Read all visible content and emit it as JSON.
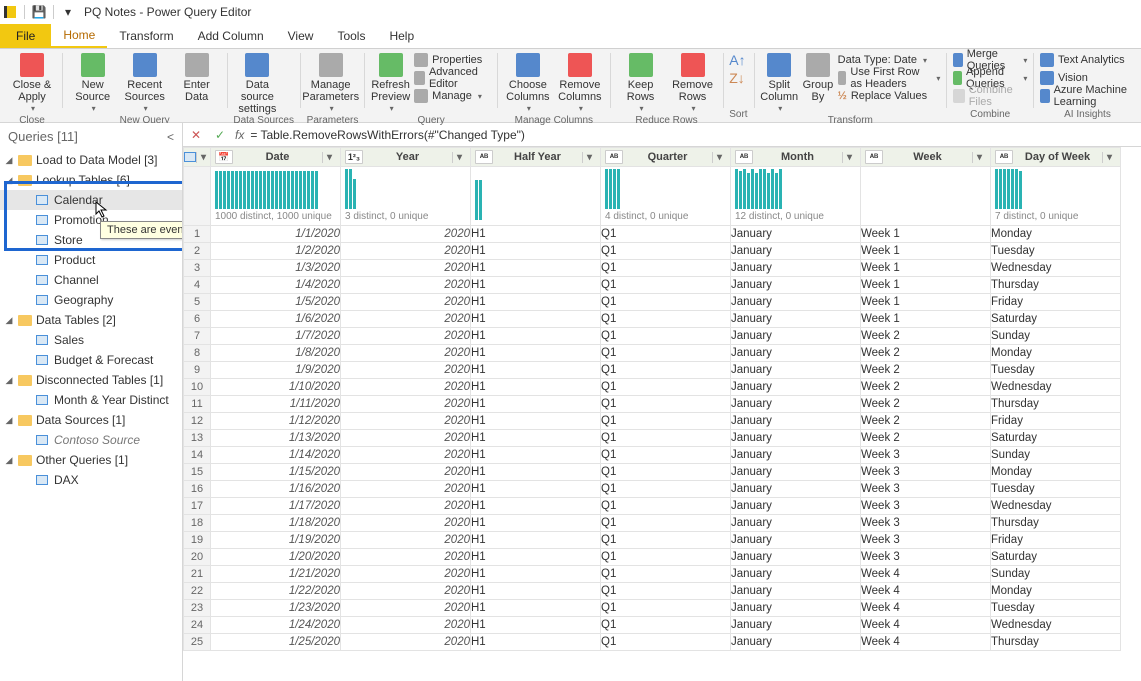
{
  "title": "PQ Notes - Power Query Editor",
  "menubar": {
    "file": "File",
    "home": "Home",
    "transform": "Transform",
    "addcol": "Add Column",
    "view": "View",
    "tools": "Tools",
    "help": "Help"
  },
  "ribbon": {
    "close": {
      "label": "Close &\nApply",
      "group": "Close"
    },
    "newq": {
      "new_source": "New\nSource",
      "recent": "Recent\nSources",
      "enter": "Enter\nData",
      "group": "New Query"
    },
    "ds": {
      "settings": "Data source\nsettings",
      "group": "Data Sources"
    },
    "params": {
      "manage": "Manage\nParameters",
      "group": "Parameters"
    },
    "query": {
      "refresh": "Refresh\nPreview",
      "props": "Properties",
      "adv": "Advanced Editor",
      "manage": "Manage",
      "group": "Query"
    },
    "mc": {
      "choose": "Choose\nColumns",
      "remove": "Remove\nColumns",
      "group": "Manage Columns"
    },
    "rr": {
      "keep": "Keep\nRows",
      "remove": "Remove\nRows",
      "group": "Reduce Rows"
    },
    "sort": {
      "group": "Sort"
    },
    "transform": {
      "split": "Split\nColumn",
      "groupby": "Group\nBy",
      "dtype": "Data Type: Date",
      "firstrow": "Use First Row as Headers",
      "replace": "Replace Values",
      "group": "Transform"
    },
    "combine": {
      "merge": "Merge Queries",
      "append": "Append Queries",
      "files": "Combine Files",
      "group": "Combine"
    },
    "ai": {
      "text": "Text Analytics",
      "vision": "Vision",
      "ml": "Azure Machine Learning",
      "group": "AI Insights"
    }
  },
  "sidebar": {
    "header": "Queries [11]",
    "g1": {
      "label": "Load to Data Model [3]"
    },
    "g2": {
      "label": "Lookup Tables [6]",
      "items": [
        "Calendar",
        "Promotion",
        "Store",
        "Product",
        "Channel",
        "Geography"
      ]
    },
    "g3": {
      "label": "Data Tables [2]",
      "items": [
        "Sales",
        "Budget & Forecast"
      ]
    },
    "g4": {
      "label": "Disconnected Tables [1]",
      "items": [
        "Month & Year Distinct"
      ]
    },
    "g5": {
      "label": "Data Sources [1]",
      "items": [
        "Contoso Source"
      ]
    },
    "g6": {
      "label": "Other Queries [1]",
      "items": [
        "DAX"
      ]
    }
  },
  "tooltip": "These are even more notes!",
  "formula": {
    "fx": "fx",
    "text": "= Table.RemoveRowsWithErrors(#\"Changed Type\")"
  },
  "columns": [
    {
      "name": "Date",
      "type": "date",
      "profile": "1000 distinct, 1000 unique",
      "bars": 26,
      "heights": [
        38,
        38,
        38,
        38,
        38,
        38,
        38,
        38,
        38,
        38,
        38,
        38,
        38,
        38,
        38,
        38,
        38,
        38,
        38,
        38,
        38,
        38,
        38,
        38,
        38,
        38
      ]
    },
    {
      "name": "Year",
      "type": "num",
      "profile": "3 distinct, 0 unique",
      "bars": 3,
      "heights": [
        40,
        40,
        30
      ]
    },
    {
      "name": "Half Year",
      "type": "text",
      "profile": "",
      "bars": 2,
      "heights": [
        40,
        40
      ]
    },
    {
      "name": "Quarter",
      "type": "text",
      "profile": "4 distinct, 0 unique",
      "bars": 4,
      "heights": [
        40,
        40,
        40,
        40
      ]
    },
    {
      "name": "Month",
      "type": "text",
      "profile": "12 distinct, 0 unique",
      "bars": 12,
      "heights": [
        40,
        38,
        40,
        36,
        40,
        36,
        40,
        40,
        36,
        40,
        36,
        40
      ]
    },
    {
      "name": "Week",
      "type": "text",
      "profile": "",
      "bars": 0,
      "heights": []
    },
    {
      "name": "Day of Week",
      "type": "text",
      "profile": "7 distinct, 0 unique",
      "bars": 7,
      "heights": [
        40,
        40,
        40,
        40,
        40,
        40,
        38
      ]
    }
  ],
  "rows": [
    {
      "n": 1,
      "Date": "1/1/2020",
      "Year": 2020,
      "Half Year": "H1",
      "Quarter": "Q1",
      "Month": "January",
      "Week": "Week 1",
      "Day of Week": "Monday"
    },
    {
      "n": 2,
      "Date": "1/2/2020",
      "Year": 2020,
      "Half Year": "H1",
      "Quarter": "Q1",
      "Month": "January",
      "Week": "Week 1",
      "Day of Week": "Tuesday"
    },
    {
      "n": 3,
      "Date": "1/3/2020",
      "Year": 2020,
      "Half Year": "H1",
      "Quarter": "Q1",
      "Month": "January",
      "Week": "Week 1",
      "Day of Week": "Wednesday"
    },
    {
      "n": 4,
      "Date": "1/4/2020",
      "Year": 2020,
      "Half Year": "H1",
      "Quarter": "Q1",
      "Month": "January",
      "Week": "Week 1",
      "Day of Week": "Thursday"
    },
    {
      "n": 5,
      "Date": "1/5/2020",
      "Year": 2020,
      "Half Year": "H1",
      "Quarter": "Q1",
      "Month": "January",
      "Week": "Week 1",
      "Day of Week": "Friday"
    },
    {
      "n": 6,
      "Date": "1/6/2020",
      "Year": 2020,
      "Half Year": "H1",
      "Quarter": "Q1",
      "Month": "January",
      "Week": "Week 1",
      "Day of Week": "Saturday"
    },
    {
      "n": 7,
      "Date": "1/7/2020",
      "Year": 2020,
      "Half Year": "H1",
      "Quarter": "Q1",
      "Month": "January",
      "Week": "Week 2",
      "Day of Week": "Sunday"
    },
    {
      "n": 8,
      "Date": "1/8/2020",
      "Year": 2020,
      "Half Year": "H1",
      "Quarter": "Q1",
      "Month": "January",
      "Week": "Week 2",
      "Day of Week": "Monday"
    },
    {
      "n": 9,
      "Date": "1/9/2020",
      "Year": 2020,
      "Half Year": "H1",
      "Quarter": "Q1",
      "Month": "January",
      "Week": "Week 2",
      "Day of Week": "Tuesday"
    },
    {
      "n": 10,
      "Date": "1/10/2020",
      "Year": 2020,
      "Half Year": "H1",
      "Quarter": "Q1",
      "Month": "January",
      "Week": "Week 2",
      "Day of Week": "Wednesday"
    },
    {
      "n": 11,
      "Date": "1/11/2020",
      "Year": 2020,
      "Half Year": "H1",
      "Quarter": "Q1",
      "Month": "January",
      "Week": "Week 2",
      "Day of Week": "Thursday"
    },
    {
      "n": 12,
      "Date": "1/12/2020",
      "Year": 2020,
      "Half Year": "H1",
      "Quarter": "Q1",
      "Month": "January",
      "Week": "Week 2",
      "Day of Week": "Friday"
    },
    {
      "n": 13,
      "Date": "1/13/2020",
      "Year": 2020,
      "Half Year": "H1",
      "Quarter": "Q1",
      "Month": "January",
      "Week": "Week 2",
      "Day of Week": "Saturday"
    },
    {
      "n": 14,
      "Date": "1/14/2020",
      "Year": 2020,
      "Half Year": "H1",
      "Quarter": "Q1",
      "Month": "January",
      "Week": "Week 3",
      "Day of Week": "Sunday"
    },
    {
      "n": 15,
      "Date": "1/15/2020",
      "Year": 2020,
      "Half Year": "H1",
      "Quarter": "Q1",
      "Month": "January",
      "Week": "Week 3",
      "Day of Week": "Monday"
    },
    {
      "n": 16,
      "Date": "1/16/2020",
      "Year": 2020,
      "Half Year": "H1",
      "Quarter": "Q1",
      "Month": "January",
      "Week": "Week 3",
      "Day of Week": "Tuesday"
    },
    {
      "n": 17,
      "Date": "1/17/2020",
      "Year": 2020,
      "Half Year": "H1",
      "Quarter": "Q1",
      "Month": "January",
      "Week": "Week 3",
      "Day of Week": "Wednesday"
    },
    {
      "n": 18,
      "Date": "1/18/2020",
      "Year": 2020,
      "Half Year": "H1",
      "Quarter": "Q1",
      "Month": "January",
      "Week": "Week 3",
      "Day of Week": "Thursday"
    },
    {
      "n": 19,
      "Date": "1/19/2020",
      "Year": 2020,
      "Half Year": "H1",
      "Quarter": "Q1",
      "Month": "January",
      "Week": "Week 3",
      "Day of Week": "Friday"
    },
    {
      "n": 20,
      "Date": "1/20/2020",
      "Year": 2020,
      "Half Year": "H1",
      "Quarter": "Q1",
      "Month": "January",
      "Week": "Week 3",
      "Day of Week": "Saturday"
    },
    {
      "n": 21,
      "Date": "1/21/2020",
      "Year": 2020,
      "Half Year": "H1",
      "Quarter": "Q1",
      "Month": "January",
      "Week": "Week 4",
      "Day of Week": "Sunday"
    },
    {
      "n": 22,
      "Date": "1/22/2020",
      "Year": 2020,
      "Half Year": "H1",
      "Quarter": "Q1",
      "Month": "January",
      "Week": "Week 4",
      "Day of Week": "Monday"
    },
    {
      "n": 23,
      "Date": "1/23/2020",
      "Year": 2020,
      "Half Year": "H1",
      "Quarter": "Q1",
      "Month": "January",
      "Week": "Week 4",
      "Day of Week": "Tuesday"
    },
    {
      "n": 24,
      "Date": "1/24/2020",
      "Year": 2020,
      "Half Year": "H1",
      "Quarter": "Q1",
      "Month": "January",
      "Week": "Week 4",
      "Day of Week": "Wednesday"
    },
    {
      "n": 25,
      "Date": "1/25/2020",
      "Year": 2020,
      "Half Year": "H1",
      "Quarter": "Q1",
      "Month": "January",
      "Week": "Week 4",
      "Day of Week": "Thursday"
    }
  ],
  "type_icons": {
    "date": "📅",
    "num": "1²₃",
    "text": "ABC\n123"
  }
}
